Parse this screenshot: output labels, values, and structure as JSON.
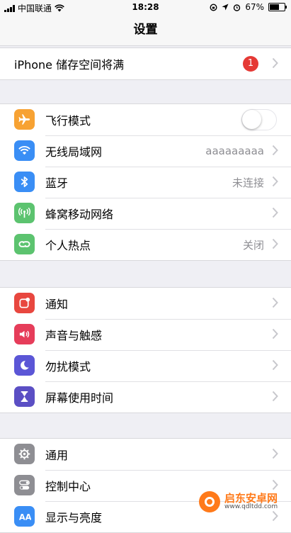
{
  "status_bar": {
    "carrier": "中国联通",
    "time": "18:28",
    "battery_percent": "67%",
    "battery_level": 0.67
  },
  "nav": {
    "title": "设置"
  },
  "storage": {
    "label": "iPhone 储存空间将满",
    "badge": "1"
  },
  "connectivity": {
    "airplane": {
      "label": "飞行模式",
      "icon": "airplane-icon",
      "color": "#f7a233",
      "enabled": false
    },
    "wifi": {
      "label": "无线局域网",
      "value": "aaaaaaaaa",
      "icon": "wifi-icon",
      "color": "#3a8ef5"
    },
    "bluetooth": {
      "label": "蓝牙",
      "value": "未连接",
      "icon": "bluetooth-icon",
      "color": "#3a8ef5"
    },
    "cellular": {
      "label": "蜂窝移动网络",
      "icon": "antenna-icon",
      "color": "#5cc36f"
    },
    "hotspot": {
      "label": "个人热点",
      "value": "关闭",
      "icon": "hotspot-icon",
      "color": "#5cc36f"
    }
  },
  "notifications_group": {
    "notifications": {
      "label": "通知",
      "icon": "notification-icon",
      "color": "#e8473f"
    },
    "sounds": {
      "label": "声音与触感",
      "icon": "speaker-icon",
      "color": "#e63d5a"
    },
    "dnd": {
      "label": "勿扰模式",
      "icon": "moon-icon",
      "color": "#5b56d6"
    },
    "screen_time": {
      "label": "屏幕使用时间",
      "icon": "hourglass-icon",
      "color": "#5b4fc4"
    }
  },
  "general_group": {
    "general": {
      "label": "通用",
      "icon": "gear-icon",
      "color": "#8e8e93"
    },
    "control_center": {
      "label": "控制中心",
      "icon": "switches-icon",
      "color": "#8e8e93"
    },
    "display": {
      "label": "显示与亮度",
      "icon": "display-icon",
      "color": "#3a8ef5"
    }
  },
  "watermark": {
    "title": "启东安卓网",
    "url": "www.qdltdd.com"
  }
}
